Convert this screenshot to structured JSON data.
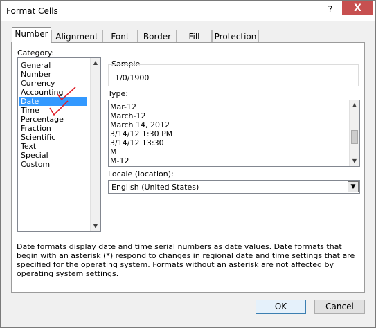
{
  "window": {
    "title": "Format Cells",
    "help": "?",
    "close": "X"
  },
  "tabs": [
    "Number",
    "Alignment",
    "Font",
    "Border",
    "Fill",
    "Protection"
  ],
  "category": {
    "label": "Category:",
    "items": [
      "General",
      "Number",
      "Currency",
      "Accounting",
      "Date",
      "Time",
      "Percentage",
      "Fraction",
      "Scientific",
      "Text",
      "Special",
      "Custom"
    ],
    "selected": "Date"
  },
  "sample": {
    "label": "Sample",
    "value": "1/0/1900"
  },
  "type": {
    "label": "Type:",
    "items": [
      "Mar-12",
      "March-12",
      "March 14, 2012",
      "3/14/12 1:30 PM",
      "3/14/12 13:30",
      "M",
      "M-12"
    ]
  },
  "locale": {
    "label": "Locale (location):",
    "value": "English (United States)"
  },
  "description": "Date formats display date and time serial numbers as date values.  Date formats that begin with an asterisk (*) respond to changes in regional date and time settings that are specified for the operating system. Formats without an asterisk are not affected by operating system settings.",
  "buttons": {
    "ok": "OK",
    "cancel": "Cancel"
  },
  "colors": {
    "selection": "#3399ff",
    "close": "#c75050",
    "annotation": "#e0202a"
  },
  "annotations": [
    "checkmark-on-accounting",
    "checkmark-on-time"
  ]
}
